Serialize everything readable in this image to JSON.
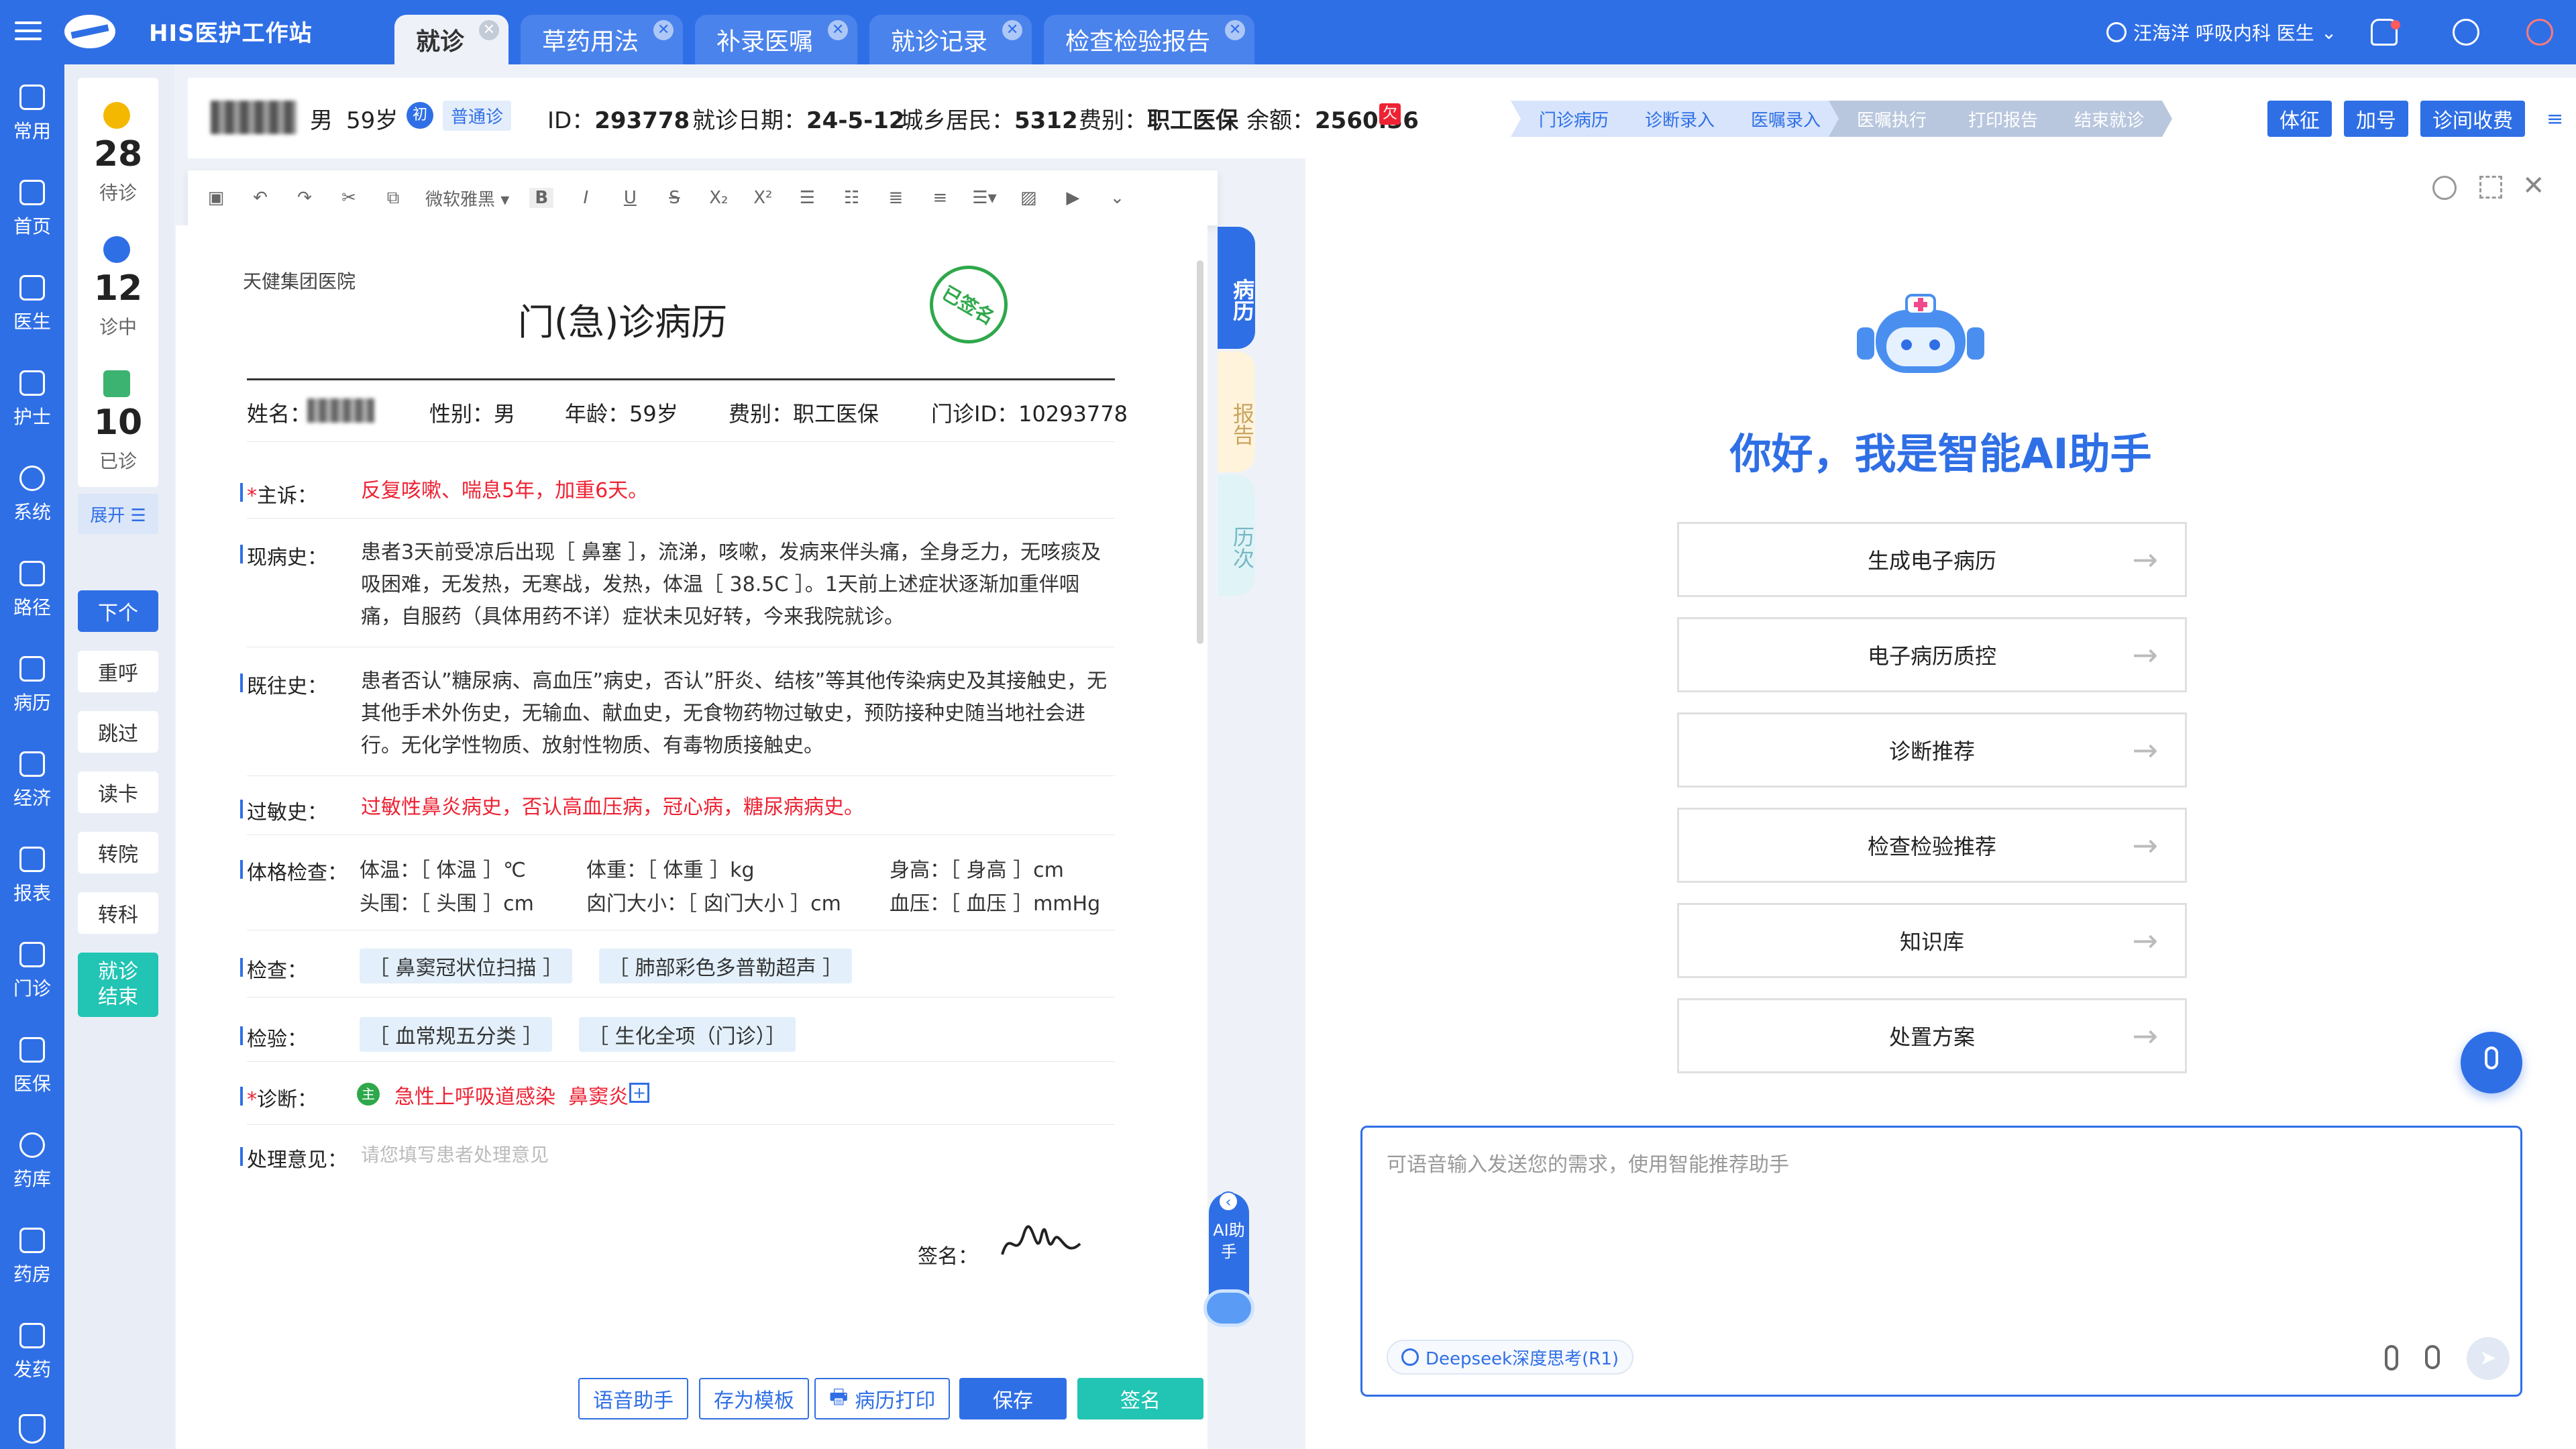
{
  "app": {
    "title": "HIS医护工作站"
  },
  "tabs": [
    "就诊",
    "草药用法",
    "补录医嘱",
    "就诊记录",
    "检查检验报告"
  ],
  "user": {
    "label": "汪海洋 呼吸内科 医生"
  },
  "nav": [
    "常用",
    "首页",
    "医生",
    "护士",
    "系统",
    "路径",
    "病历",
    "经济",
    "报表",
    "门诊",
    "医保",
    "药库",
    "药房",
    "发药"
  ],
  "queue": {
    "waiting": {
      "count": "28",
      "label": "待诊"
    },
    "inprogress": {
      "count": "12",
      "label": "诊中"
    },
    "done": {
      "count": "10",
      "label": "已诊"
    },
    "expand": "展开 ☰",
    "buttons": [
      "下个",
      "重呼",
      "跳过",
      "读卡",
      "转院",
      "转科",
      "就诊结束"
    ]
  },
  "patient": {
    "gender": "男",
    "age": "59岁",
    "first": "初",
    "type": "普通诊",
    "id_label": "ID：",
    "id": "293778",
    "date_label": "就诊日期：",
    "date": "24-5-12",
    "insurance_label": "城乡居民：",
    "insurance": "5312",
    "fee_label": "费别：",
    "fee": "职工医保",
    "balance_label": "余额：",
    "balance": "2560.36",
    "owe": "欠"
  },
  "steps": [
    "门诊病历",
    "诊断录入",
    "医嘱录入",
    "医嘱执行",
    "打印报告",
    "结束就诊"
  ],
  "header_buttons": [
    "体征",
    "加号",
    "诊间收费"
  ],
  "toolbar": {
    "font": "微软雅黑"
  },
  "record": {
    "hospital": "天健集团医院",
    "title": "门(急)诊病历",
    "stamp": "已签名",
    "name_label": "姓名：",
    "gender": "性别：男",
    "age": "年龄：59岁",
    "fee": "费别：职工医保",
    "clinic_id": "门诊ID：10293778",
    "complaint_label": "主诉：",
    "complaint": "反复咳嗽、喘息5年，加重6天。",
    "history_label": "现病史：",
    "history": "患者3天前受凉后出现［ 鼻塞 ］，流涕，咳嗽，发病来伴头痛，全身乏力，无咳痰及吸困难，无发热，无寒战，发热，体温［ 38.5C ］。1天前上述症状逐渐加重伴咽痛，自服药（具体用药不详）症状未见好转，今来我院就诊。",
    "past_label": "既往史：",
    "past": "患者否认”糖尿病、高血压”病史，否认”肝炎、结核”等其他传染病史及其接触史，无其他手术外伤史，无输血、献血史，无食物药物过敏史，预防接种史随当地社会进行。无化学性物质、放射性物质、有毒物质接触史。",
    "allergy_label": "过敏史：",
    "allergy": "过敏性鼻炎病史，否认高血压病，冠心病，糖尿病病史。",
    "exam_label": "体格检查：",
    "exam_temp": "体温：［ 体温 ］℃",
    "exam_weight": "体重：［ 体重 ］kg",
    "exam_height": "身高：［ 身高 ］cm",
    "exam_head": "头围：［ 头围 ］cm",
    "exam_fontanel": "囟门大小：［ 囟门大小 ］cm",
    "exam_bp": "血压：［ 血压 ］mmHg",
    "check_label": "检查：",
    "checks": [
      "［ 鼻窦冠状位扫描 ］",
      "［ 肺部彩色多普勒超声 ］"
    ],
    "lab_label": "检验：",
    "labs": [
      "［ 血常规五分类 ］",
      "［ 生化全项（门诊）］"
    ],
    "diag_label": "诊断：",
    "diag_main": "主",
    "diagnoses": "急性上呼吸道感染  鼻窦炎",
    "treat_label": "处理意见：",
    "treat_placeholder": "请您填写患者处理意见",
    "sign_label": "签名："
  },
  "side_tabs": [
    "病历",
    "报告",
    "历次"
  ],
  "ai_float": "AI助手",
  "footer_buttons": [
    "语音助手",
    "存为模板",
    "病历打印",
    "保存",
    "签名"
  ],
  "ai": {
    "greeting": "你好，我是智能AI助手",
    "menu": [
      "生成电子病历",
      "电子病历质控",
      "诊断推荐",
      "检查检验推荐",
      "知识库",
      "处置方案"
    ],
    "input_placeholder": "可语音输入发送您的需求，使用智能推荐助手",
    "model": "Deepseek深度思考(R1)"
  }
}
